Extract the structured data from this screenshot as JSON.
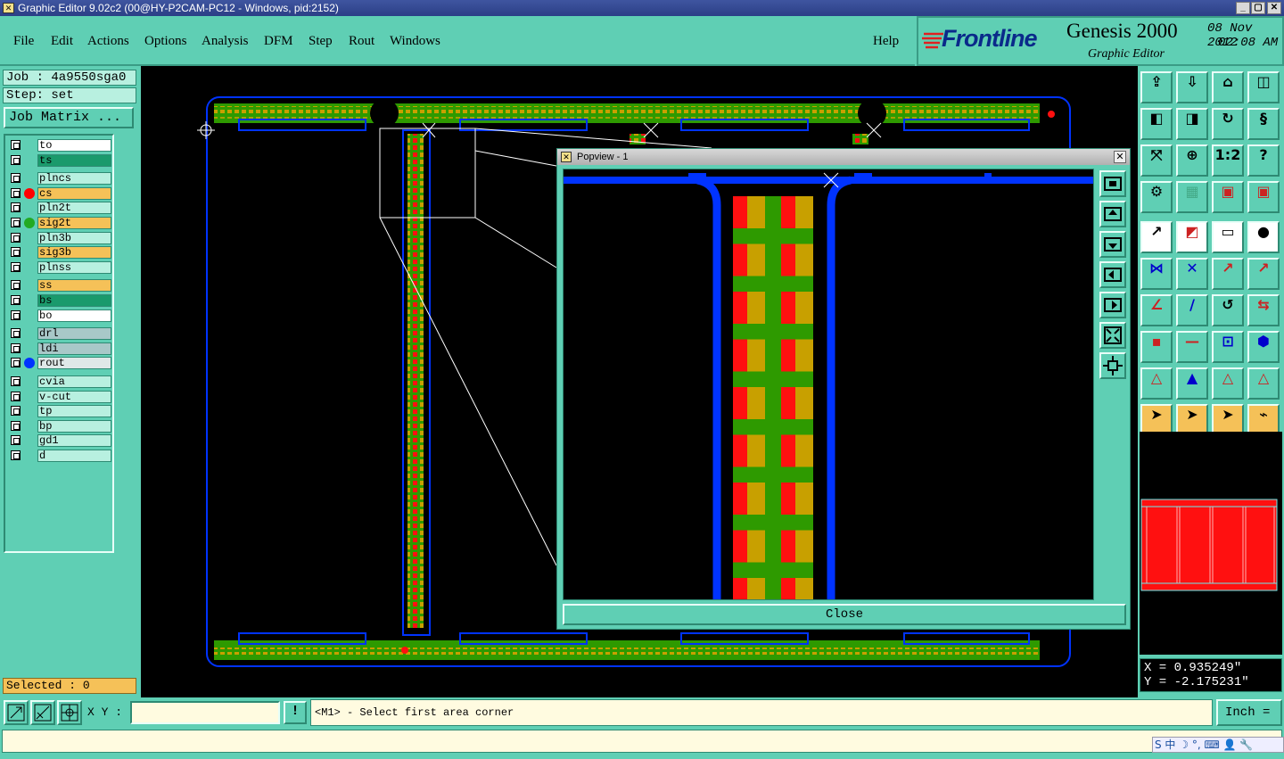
{
  "window": {
    "title": "Graphic Editor 9.02c2 (00@HY-P2CAM-PC12 - Windows, pid:2152)",
    "controls": [
      "_",
      "▢",
      "✕"
    ]
  },
  "menu": {
    "items": [
      "File",
      "Edit",
      "Actions",
      "Options",
      "Analysis",
      "DFM",
      "Step",
      "Rout",
      "Windows"
    ],
    "help": "Help"
  },
  "brand": {
    "logo": "Frontline",
    "product": "Genesis 2000",
    "subtitle": "Graphic Editor",
    "date": "08 Nov 2012",
    "time": "02:08 AM"
  },
  "job": {
    "job_label": "Job : 4a9550sga0",
    "step_label": "Step: set",
    "matrix_button": "Job Matrix ..."
  },
  "layers": [
    {
      "name": "to",
      "color": "#ffffff",
      "dot": ""
    },
    {
      "name": "ts",
      "color": "#1a9a6c",
      "dot": ""
    },
    {
      "name": "plncs",
      "color": "#b8f0e0",
      "dot": ""
    },
    {
      "name": "cs",
      "color": "#f5c158",
      "dot": "#ff0000"
    },
    {
      "name": "pln2t",
      "color": "#b8f0e0",
      "dot": ""
    },
    {
      "name": "sig2t",
      "color": "#f5c158",
      "dot": "#22aa22"
    },
    {
      "name": "pln3b",
      "color": "#b8f0e0",
      "dot": ""
    },
    {
      "name": "sig3b",
      "color": "#f5c158",
      "dot": ""
    },
    {
      "name": "plnss",
      "color": "#b8f0e0",
      "dot": ""
    },
    {
      "name": "ss",
      "color": "#f5c158",
      "dot": ""
    },
    {
      "name": "bs",
      "color": "#1a9a6c",
      "dot": ""
    },
    {
      "name": "bo",
      "color": "#ffffff",
      "dot": ""
    },
    {
      "name": "drl",
      "color": "#a8c8c8",
      "dot": ""
    },
    {
      "name": "ldi",
      "color": "#a8c8c8",
      "dot": ""
    },
    {
      "name": "rout",
      "color": "#dfe8e8",
      "dot": "#0033ff"
    },
    {
      "name": "cvia",
      "color": "#b8f0e0",
      "dot": ""
    },
    {
      "name": "v-cut",
      "color": "#b8f0e0",
      "dot": ""
    },
    {
      "name": "tp",
      "color": "#b8f0e0",
      "dot": ""
    },
    {
      "name": "bp",
      "color": "#b8f0e0",
      "dot": ""
    },
    {
      "name": "gd1",
      "color": "#b8f0e0",
      "dot": ""
    },
    {
      "name": "d",
      "color": "#b8f0e0",
      "dot": ""
    }
  ],
  "selected": "Selected : 0",
  "popup": {
    "title": "Popview - 1",
    "close_label": "Close"
  },
  "coords": {
    "x": "X =  0.935249\"",
    "y": "Y = -2.175231\""
  },
  "bottom": {
    "xy_label": "X Y :",
    "xy_value": "",
    "warn": "!",
    "message": "<M1> - Select first area corner",
    "unit": "Inch ="
  },
  "ime": "S 中 ☽ °, ⌨ 👤 🔧",
  "colors": {
    "panel": "#5fcfb4",
    "rout_blue": "#0033ff",
    "copper_green": "#2e9a00",
    "pad_red": "#ff1010",
    "pad_gold": "#c8a000"
  }
}
